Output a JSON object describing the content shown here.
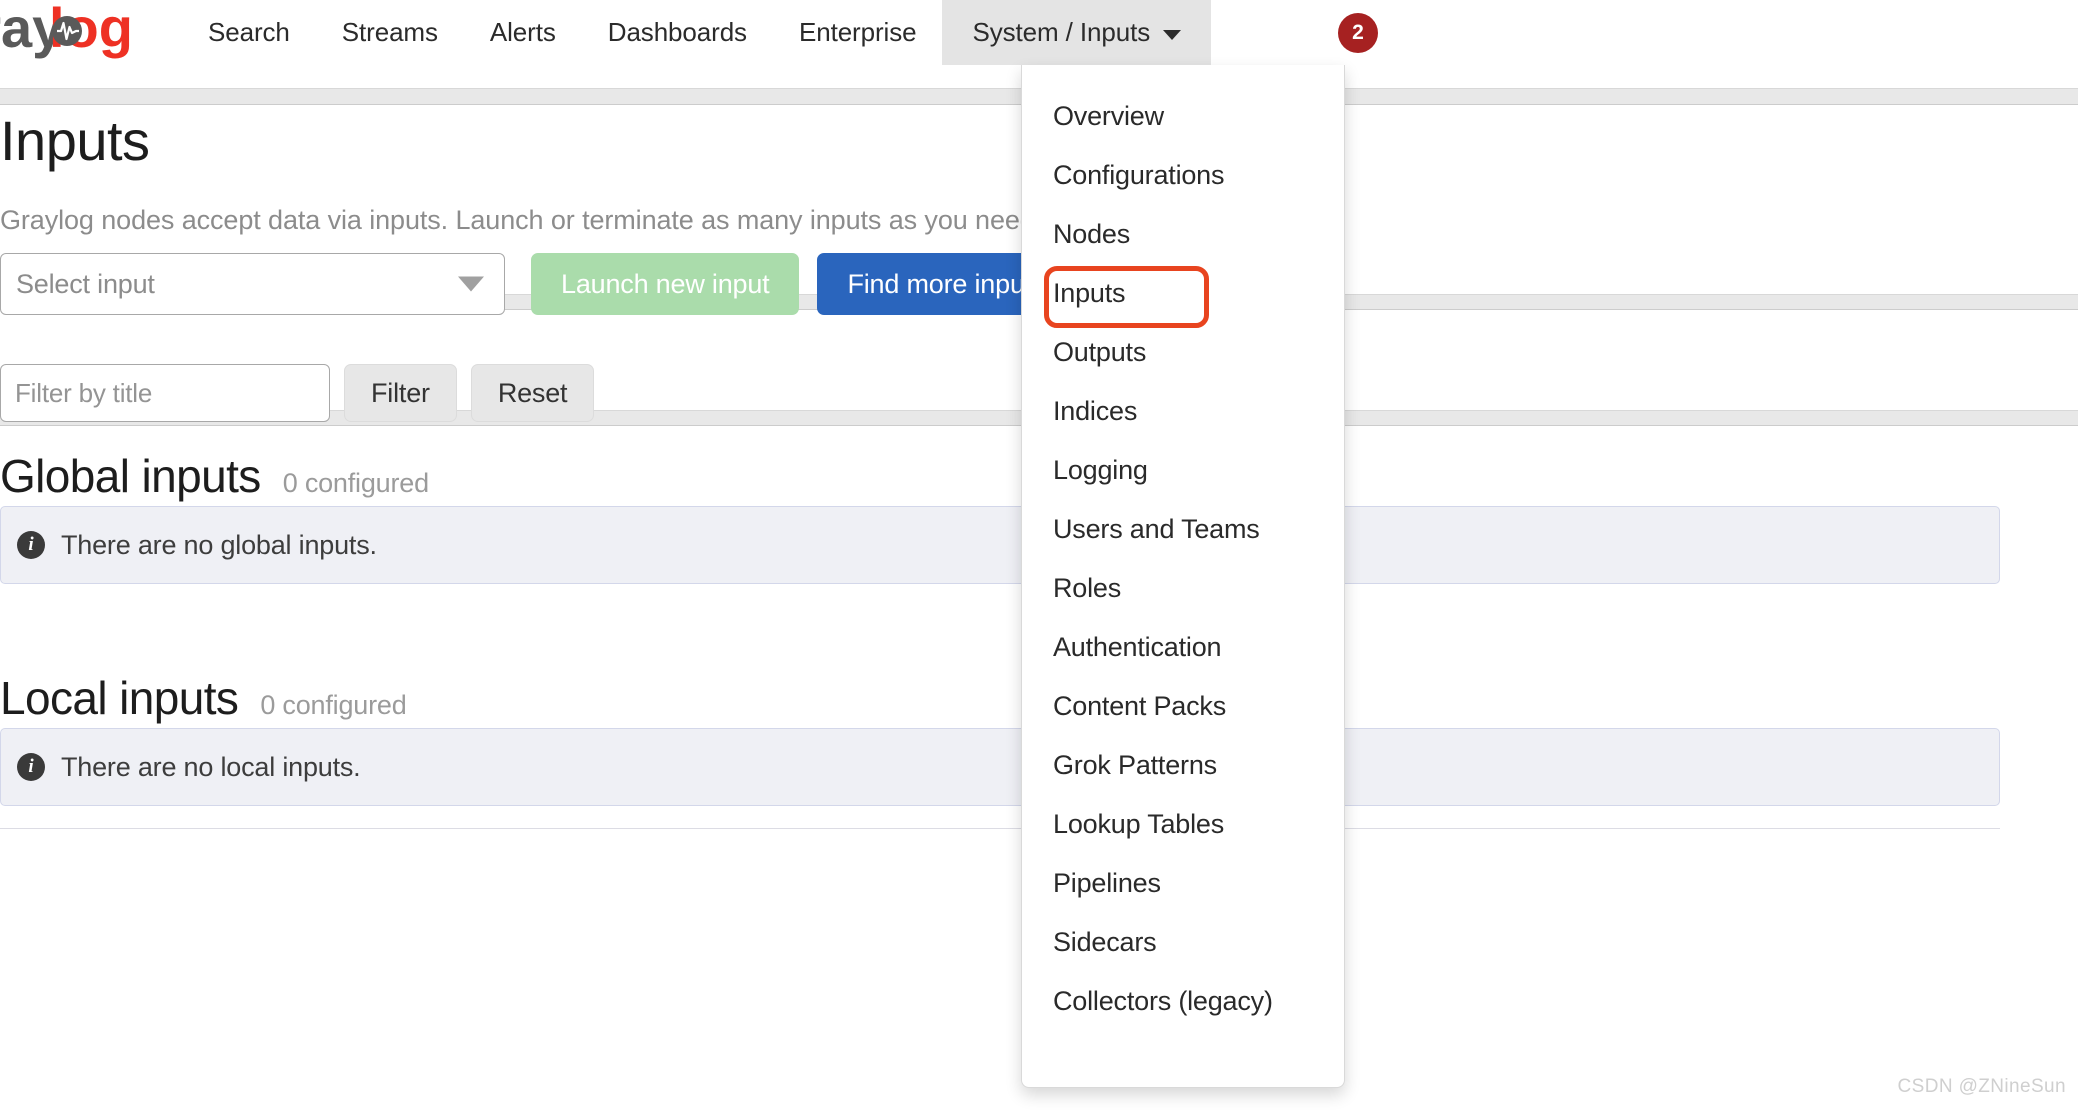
{
  "navbar": {
    "brand": {
      "text_visible": "aylog",
      "full_name": "graylog",
      "logo_accent_color": "#ee3124",
      "logo_dark_color": "#5a5a5a"
    },
    "links": [
      {
        "label": "Search",
        "active": false
      },
      {
        "label": "Streams",
        "active": false
      },
      {
        "label": "Alerts",
        "active": false
      },
      {
        "label": "Dashboards",
        "active": false
      },
      {
        "label": "Enterprise",
        "active": false
      },
      {
        "label": "System / Inputs",
        "active": true
      }
    ],
    "badge": {
      "count": "2",
      "color": "#a62121"
    }
  },
  "page": {
    "title": "Inputs",
    "description": "Graylog nodes accept data via inputs. Launch or terminate as many inputs as you need here.",
    "launch_row": {
      "select_placeholder": "Select input",
      "launch_button": "Launch new input",
      "find_button": "Find more inputs"
    },
    "filter_row": {
      "filter_placeholder": "Filter by title",
      "filter_button": "Filter",
      "reset_button": "Reset"
    },
    "sections": [
      {
        "heading": "Global inputs",
        "count_label": "0 configured",
        "empty_message": "There are no global inputs."
      },
      {
        "heading": "Local inputs",
        "count_label": "0 configured",
        "empty_message": "There are no local inputs."
      }
    ]
  },
  "dropdown": {
    "open": true,
    "highlight_color": "#e8441f",
    "items": [
      {
        "label": "Overview",
        "highlighted": false
      },
      {
        "label": "Configurations",
        "highlighted": false
      },
      {
        "label": "Nodes",
        "highlighted": false
      },
      {
        "label": "Inputs",
        "highlighted": true
      },
      {
        "label": "Outputs",
        "highlighted": false
      },
      {
        "label": "Indices",
        "highlighted": false
      },
      {
        "label": "Logging",
        "highlighted": false
      },
      {
        "label": "Users and Teams",
        "highlighted": false
      },
      {
        "label": "Roles",
        "highlighted": false
      },
      {
        "label": "Authentication",
        "highlighted": false
      },
      {
        "label": "Content Packs",
        "highlighted": false
      },
      {
        "label": "Grok Patterns",
        "highlighted": false
      },
      {
        "label": "Lookup Tables",
        "highlighted": false
      },
      {
        "label": "Pipelines",
        "highlighted": false
      },
      {
        "label": "Sidecars",
        "highlighted": false
      },
      {
        "label": "Collectors (legacy)",
        "highlighted": false
      }
    ]
  },
  "watermark": "CSDN @ZNineSun"
}
